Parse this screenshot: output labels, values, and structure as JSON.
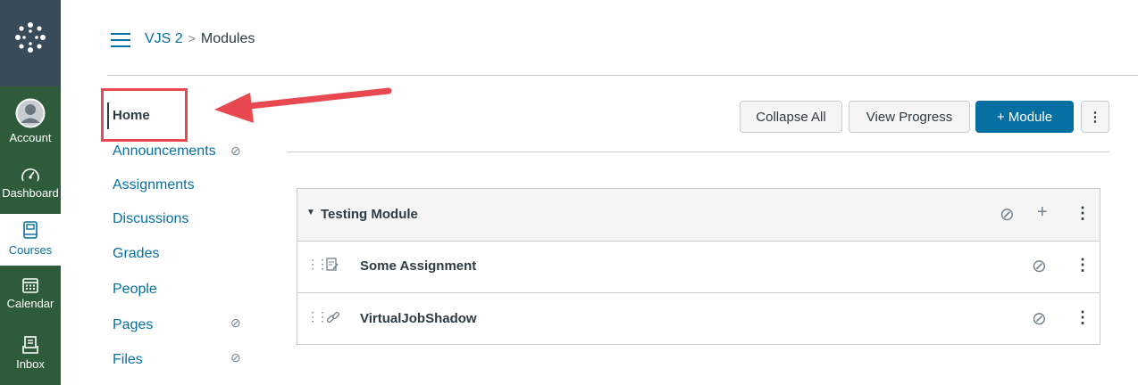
{
  "global_nav": {
    "logo_icon": "canvas-logo-icon",
    "items": [
      {
        "label": "Account",
        "icon": "account-icon"
      },
      {
        "label": "Dashboard",
        "icon": "dashboard-icon"
      },
      {
        "label": "Courses",
        "icon": "courses-icon"
      },
      {
        "label": "Calendar",
        "icon": "calendar-icon"
      },
      {
        "label": "Inbox",
        "icon": "inbox-icon"
      }
    ]
  },
  "breadcrumb": {
    "course": "VJS 2",
    "separator": ">",
    "current": "Modules"
  },
  "course_nav": [
    {
      "label": "Home",
      "hidden": false,
      "active": true
    },
    {
      "label": "Announcements",
      "hidden": true
    },
    {
      "label": "Assignments",
      "hidden": false
    },
    {
      "label": "Discussions",
      "hidden": false
    },
    {
      "label": "Grades",
      "hidden": false
    },
    {
      "label": "People",
      "hidden": false
    },
    {
      "label": "Pages",
      "hidden": true
    },
    {
      "label": "Files",
      "hidden": true
    }
  ],
  "toolbar": {
    "collapse_all": "Collapse All",
    "view_progress": "View Progress",
    "add_module": "+ Module"
  },
  "module": {
    "title": "Testing Module",
    "items": [
      {
        "title": "Some Assignment",
        "icon": "assignment-icon"
      },
      {
        "title": "VirtualJobShadow",
        "icon": "link-icon"
      }
    ]
  },
  "colors": {
    "accent": "#0770a3",
    "nav_dark": "#394b58",
    "nav_green": "#2e5c3a",
    "annotation_red": "#e8484f"
  }
}
